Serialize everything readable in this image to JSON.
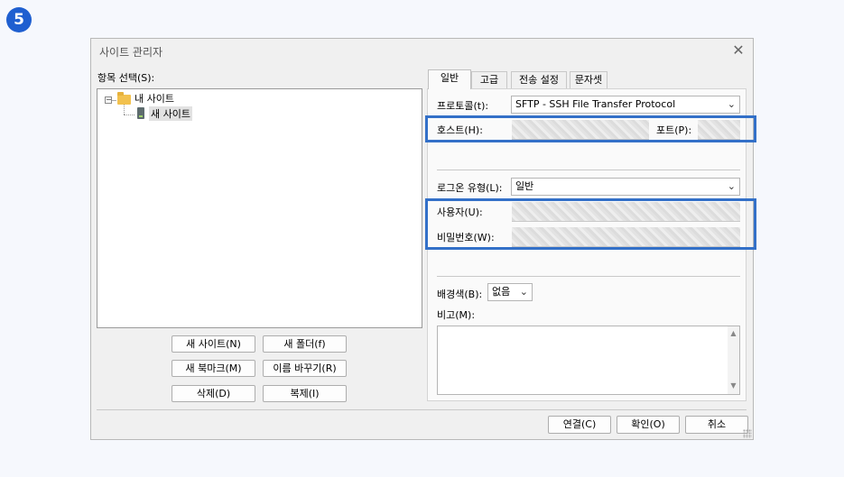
{
  "step_number": "5",
  "dialog": {
    "title": "사이트 관리자",
    "close_glyph": "✕"
  },
  "left": {
    "entries_label": "항목 선택(S):",
    "tree": {
      "expander": "−",
      "root_label": "내 사이트",
      "child_label": "새 사이트"
    },
    "buttons": {
      "new_site": "새 사이트(N)",
      "new_folder": "새 폴더(f)",
      "new_bookmark": "새 북마크(M)",
      "rename": "이름 바꾸기(R)",
      "delete": "삭제(D)",
      "duplicate": "복제(I)"
    }
  },
  "tabs": [
    "일반",
    "고급",
    "전송 설정",
    "문자셋"
  ],
  "general": {
    "protocol_label": "프로토콜(t):",
    "protocol_value": "SFTP - SSH File Transfer Protocol",
    "host_label": "호스트(H):",
    "port_label": "포트(P):",
    "logon_type_label": "로그온 유형(L):",
    "logon_type_value": "일반",
    "user_label": "사용자(U):",
    "password_label": "비밀번호(W):",
    "bg_color_label": "배경색(B):",
    "bg_color_value": "없음",
    "comments_label": "비고(M):"
  },
  "footer": {
    "connect": "연결(C)",
    "ok": "확인(O)",
    "cancel": "취소"
  },
  "icons": {
    "dropdown": "⌄",
    "scroll_up": "▲",
    "scroll_down": "▼"
  },
  "colors": {
    "highlight_border": "#3370c8",
    "step_badge": "#1f5fd0"
  }
}
